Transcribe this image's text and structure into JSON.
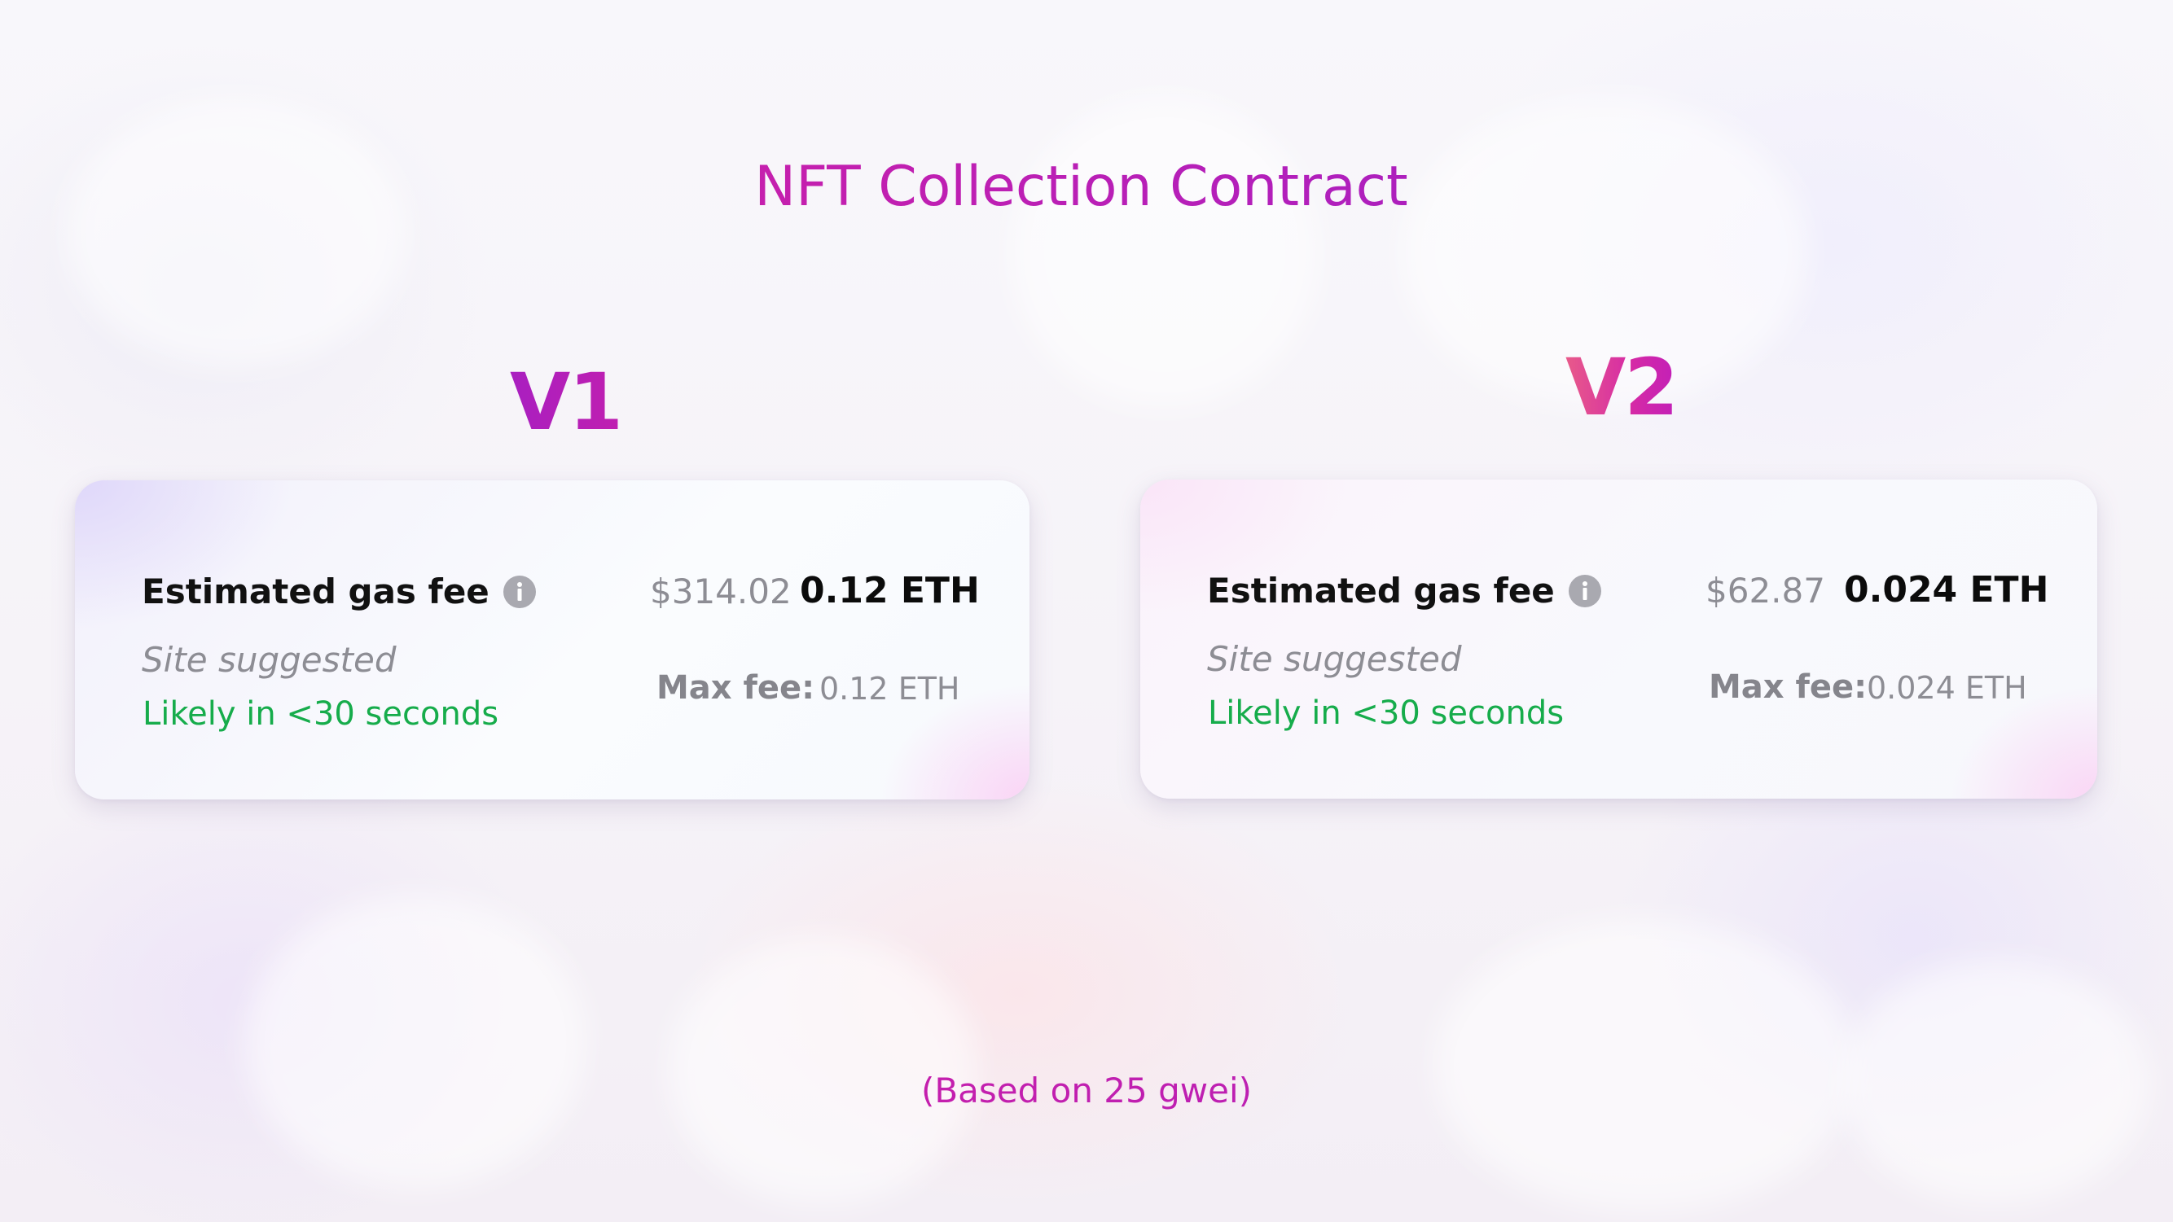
{
  "page": {
    "title": "NFT Collection Contract",
    "note": "(Based on 25 gwei)"
  },
  "colors": {
    "title_gradient_start": "#e0209a",
    "title_gradient_end": "#8a1fc8",
    "likely_green": "#16ac4b",
    "muted_gray": "#8d8d94",
    "strong_text": "#111111"
  },
  "cards": [
    {
      "version": "V1",
      "gas_label": "Estimated gas fee",
      "info_icon": "info-icon",
      "usd": "$314.02",
      "eth": "0.12 ETH",
      "suggested": "Site suggested",
      "likely": "Likely in <30 seconds",
      "maxfee_label": "Max fee:",
      "maxfee_value": "0.12 ETH"
    },
    {
      "version": "V2",
      "gas_label": "Estimated gas fee",
      "info_icon": "info-icon",
      "usd": "$62.87",
      "eth": "0.024 ETH",
      "suggested": "Site suggested",
      "likely": "Likely in <30 seconds",
      "maxfee_label": "Max fee:",
      "maxfee_value": "0.024 ETH"
    }
  ]
}
